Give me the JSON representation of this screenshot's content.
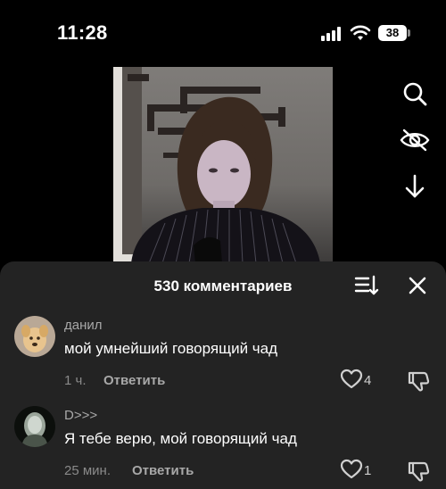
{
  "status_bar": {
    "time": "11:28",
    "battery": "38"
  },
  "side_icons": [
    "search-icon",
    "eye-slash-icon",
    "download-arrow-icon"
  ],
  "comments_panel": {
    "title": "530 комментариев",
    "comments": [
      {
        "author": "данил",
        "text": "мой умнейший говорящий чад",
        "time": "1 ч.",
        "reply_label": "Ответить",
        "likes": "4"
      },
      {
        "author": "D>>>",
        "text": "Я тебе верю, мой говорящий чад",
        "time": "25 мин.",
        "reply_label": "Ответить",
        "likes": "1"
      }
    ]
  },
  "colors": {
    "sheet_bg": "#232323",
    "text_primary": "#ffffff",
    "text_secondary": "#a8a8a8"
  }
}
